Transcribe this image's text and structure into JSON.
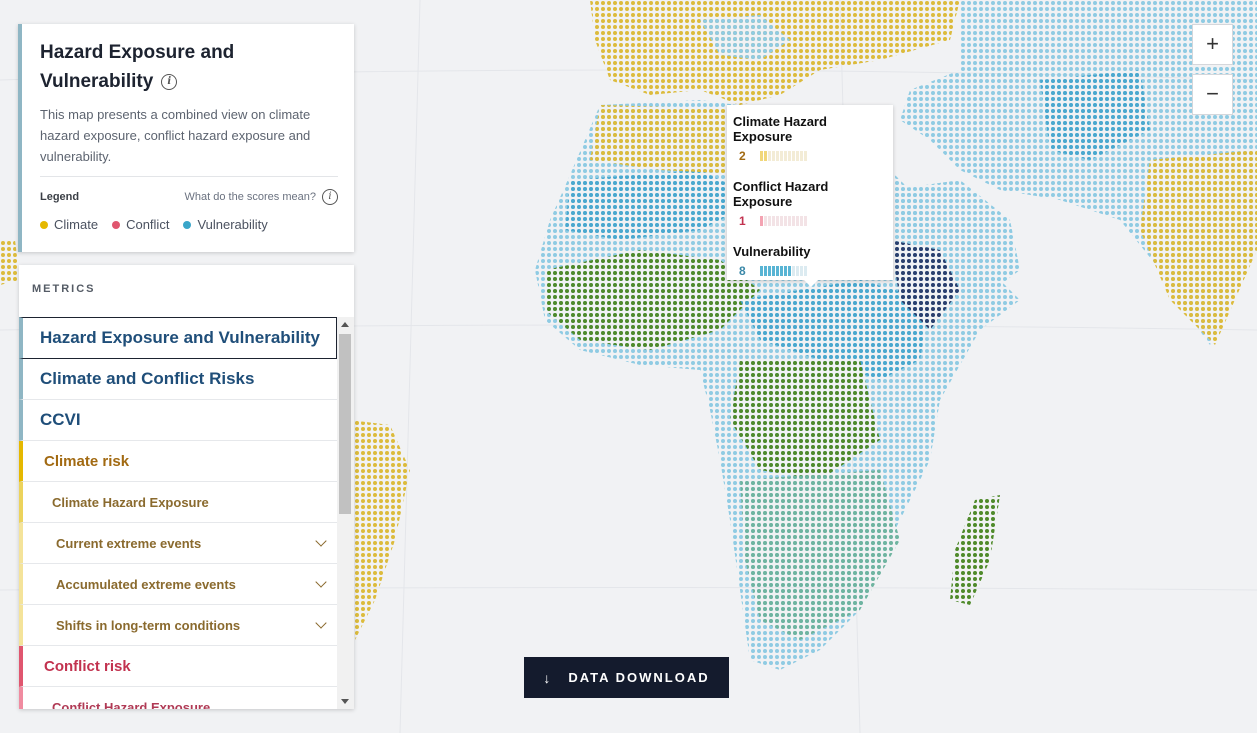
{
  "info_card": {
    "title": "Hazard Exposure and Vulnerability",
    "description": "This map presents a combined view on climate hazard exposure, conflict hazard exposure and vulnerability.",
    "legend_label": "Legend",
    "legend_help": "What do the scores mean?",
    "legend": [
      {
        "label": "Climate",
        "color": "#e5b800"
      },
      {
        "label": "Conflict",
        "color": "#e0566f"
      },
      {
        "label": "Vulnerability",
        "color": "#3aa6c9"
      }
    ]
  },
  "metrics": {
    "title": "METRICS",
    "items": [
      {
        "label": "Hazard Exposure and Vulnerability",
        "level": 0,
        "color": "#1f4e79",
        "bar": "#8fb6c4",
        "selected": true,
        "expandable": false
      },
      {
        "label": "Climate and Conflict Risks",
        "level": 0,
        "color": "#1f4e79",
        "bar": "#8fb6c4",
        "selected": false,
        "expandable": false
      },
      {
        "label": "CCVI",
        "level": 0,
        "color": "#1f4e79",
        "bar": "#8fb6c4",
        "selected": false,
        "expandable": false
      },
      {
        "label": "Climate risk",
        "level": 1,
        "color": "#a26a12",
        "bar": "#e5b800",
        "selected": false,
        "expandable": false
      },
      {
        "label": "Climate Hazard Exposure",
        "level": 2,
        "color": "#8a6a2e",
        "bar": "#ecd35c",
        "selected": false,
        "expandable": false
      },
      {
        "label": "Current extreme events",
        "level": 3,
        "color": "#8a6a2e",
        "bar": "#f4e39a",
        "selected": false,
        "expandable": true
      },
      {
        "label": "Accumulated extreme events",
        "level": 3,
        "color": "#8a6a2e",
        "bar": "#f4e39a",
        "selected": false,
        "expandable": true
      },
      {
        "label": "Shifts in long-term conditions",
        "level": 3,
        "color": "#8a6a2e",
        "bar": "#f4e39a",
        "selected": false,
        "expandable": true
      },
      {
        "label": "Conflict risk",
        "level": 1,
        "color": "#c2324f",
        "bar": "#e0566f",
        "selected": false,
        "expandable": false
      },
      {
        "label": "Conflict Hazard Exposure",
        "level": 2,
        "color": "#b03a55",
        "bar": "#f08ba0",
        "selected": false,
        "expandable": false
      }
    ]
  },
  "zoom": {
    "in": "+",
    "out": "−"
  },
  "tooltip": {
    "climate": {
      "title": "Climate Hazard Exposure",
      "score": "2",
      "value": 2,
      "color": "#a26a12",
      "fill": "#f1d77a",
      "empty": "#f3ecd6"
    },
    "conflict": {
      "title": "Conflict Hazard Exposure",
      "score": "1",
      "value": 1,
      "color": "#c2324f",
      "fill": "#f4a3b2",
      "empty": "#f3e3e6"
    },
    "vulnerability": {
      "title": "Vulnerability",
      "score": "8",
      "value": 8,
      "color": "#3a88a8",
      "fill": "#58b4d4",
      "empty": "#dcebf1"
    }
  },
  "download": {
    "label": "DATA DOWNLOAD"
  }
}
